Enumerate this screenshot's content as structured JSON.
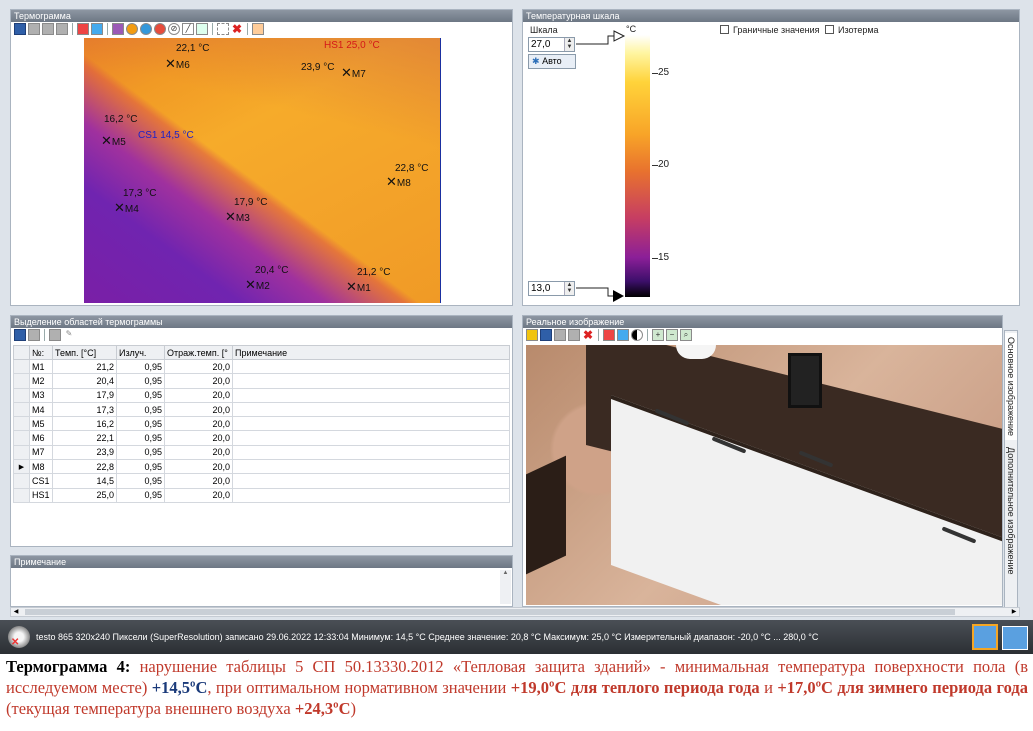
{
  "panels": {
    "thermogram_title": "Термограмма",
    "scale_title": "Температурная шкала",
    "regions_title": "Выделение областей термограммы",
    "real_title": "Реальное изображение",
    "note_title": "Примечание"
  },
  "thermogram": {
    "markers": [
      {
        "name": "M6",
        "temp": "22,1 °C"
      },
      {
        "name": "M7",
        "temp": "23,9 °C"
      },
      {
        "name": "M5",
        "temp": "16,2 °C"
      },
      {
        "name": "M8",
        "temp": "22,8 °C"
      },
      {
        "name": "M4",
        "temp": "17,3 °C"
      },
      {
        "name": "M3",
        "temp": "17,9 °C"
      },
      {
        "name": "M2",
        "temp": "20,4 °C"
      },
      {
        "name": "M1",
        "temp": "21,2 °C"
      }
    ],
    "hs_label": "HS1 25,0 °C",
    "cs_label": "CS1 14,5 °C"
  },
  "scale": {
    "label": "Шкала",
    "max_value": "27,0",
    "min_value": "13,0",
    "auto_label": "Авто",
    "unit": "°C",
    "ticks": [
      "25",
      "20",
      "15"
    ],
    "checkbox_limits": "Граничные значения",
    "checkbox_isotherm": "Изотерма"
  },
  "table": {
    "headers": [
      "№:",
      "Темп. [°C]",
      "Излуч.",
      "Отраж.темп. [°",
      "Примечание"
    ],
    "rows": [
      [
        "M1",
        "21,2",
        "0,95",
        "20,0",
        ""
      ],
      [
        "M2",
        "20,4",
        "0,95",
        "20,0",
        ""
      ],
      [
        "M3",
        "17,9",
        "0,95",
        "20,0",
        ""
      ],
      [
        "M4",
        "17,3",
        "0,95",
        "20,0",
        ""
      ],
      [
        "M5",
        "16,2",
        "0,95",
        "20,0",
        ""
      ],
      [
        "M6",
        "22,1",
        "0,95",
        "20,0",
        ""
      ],
      [
        "M7",
        "23,9",
        "0,95",
        "20,0",
        ""
      ],
      [
        "M8",
        "22,8",
        "0,95",
        "20,0",
        ""
      ],
      [
        "CS1",
        "14,5",
        "0,95",
        "20,0",
        ""
      ],
      [
        "HS1",
        "25,0",
        "0,95",
        "20,0",
        ""
      ]
    ]
  },
  "side_tabs": [
    "Основное изображение",
    "Дополнительное изображение"
  ],
  "status": "testo 865 320x240 Пиксели (SuperResolution) записано 29.06.2022 12:33:04 Минимум: 14,5 °C Среднее значение: 20,8 °C Максимум: 25,0 °C Измерительный диапазон: -20,0 °C ... 280,0 °C",
  "caption": {
    "lead": "Термограмма  4:",
    "p1": " нарушение таблицы 5 СП 50.13330.2012 «Тепловая защита зданий» - минимальная температура поверхности пола (в исследуемом месте) ",
    "v1": "+14,5ºC",
    "p2": ", при оптимальном нормативном значении ",
    "v2": "+19,0ºC для теплого периода года",
    "p3": " и ",
    "v3": "+17,0ºC для зимнего периода года",
    "p4": " (текущая температура внешнего воздуха ",
    "v4": "+24,3ºC",
    "p5": ")"
  }
}
